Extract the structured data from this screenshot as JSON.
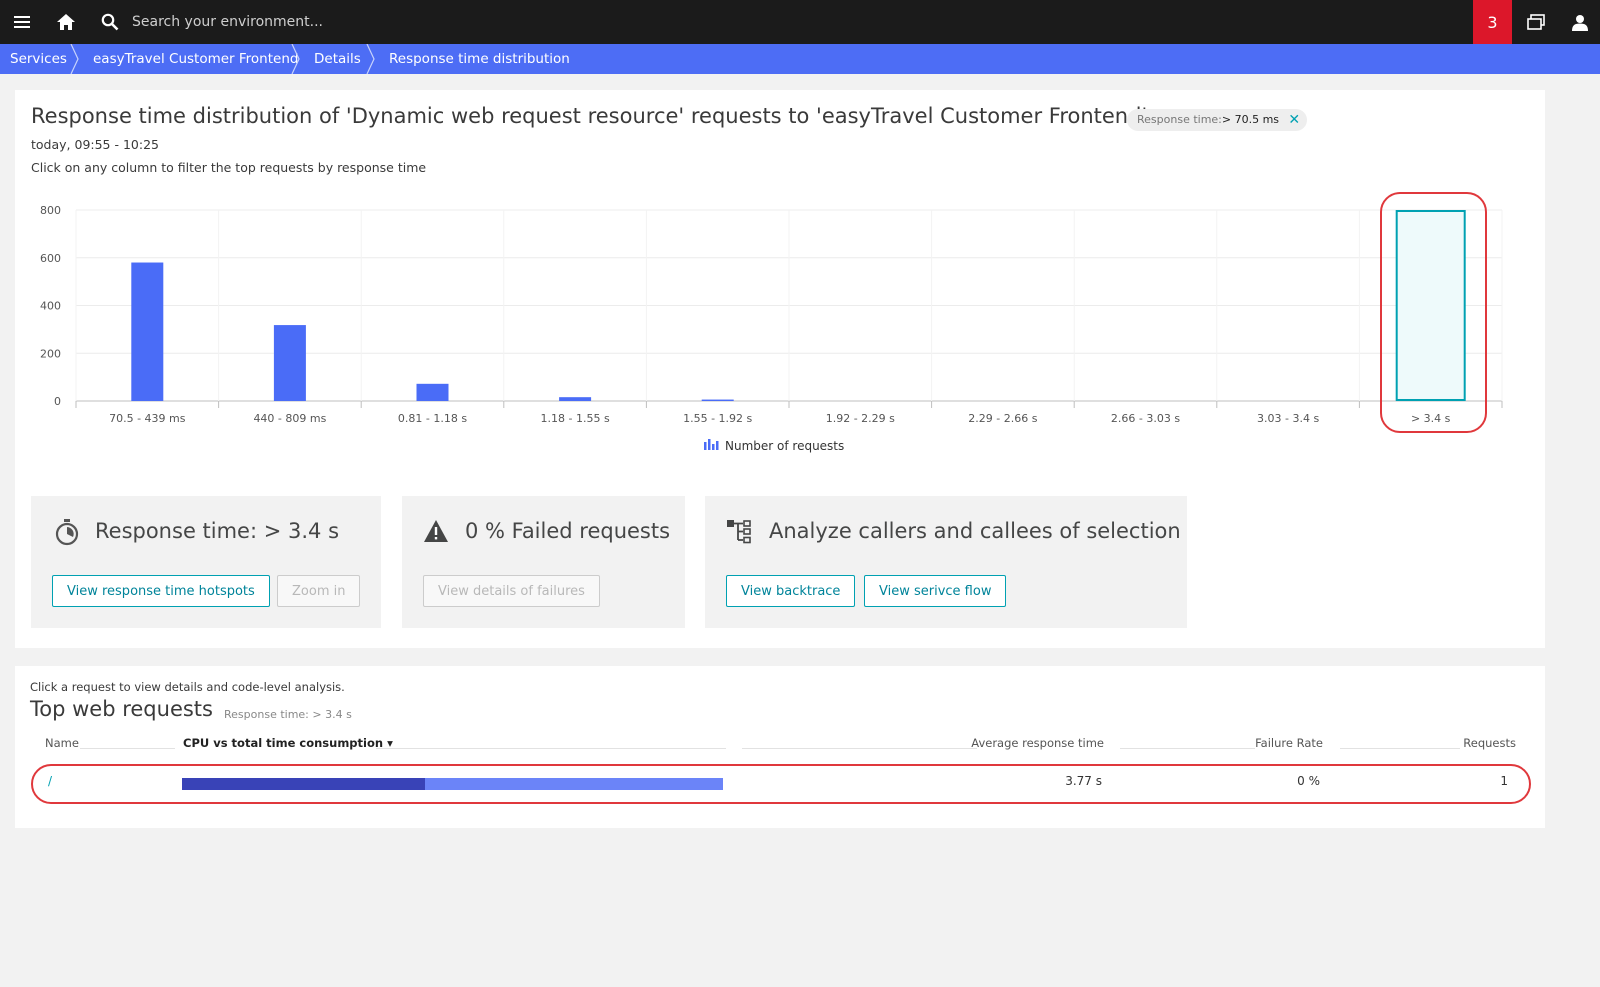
{
  "topbar": {
    "search_placeholder": "Search your environment...",
    "notification_count": "3"
  },
  "breadcrumb": [
    "Services",
    "easyTravel Customer Frontend",
    "Details",
    "Response time distribution"
  ],
  "header": {
    "title": "Response time distribution of 'Dynamic web request resource' requests to 'easyTravel Customer Frontend'",
    "filter_chip": {
      "label": "Response time:",
      "value": "> 70.5 ms"
    },
    "timeframe": "today, 09:55 - 10:25",
    "hint": "Click on any column to filter the top requests by response time"
  },
  "chart_data": {
    "type": "bar",
    "categories": [
      "70.5 - 439 ms",
      "440 - 809 ms",
      "0.81 - 1.18 s",
      "1.18 - 1.55 s",
      "1.55 - 1.92 s",
      "1.92 - 2.29 s",
      "2.29 - 2.66 s",
      "2.66 - 3.03 s",
      "3.03 - 3.4 s",
      "> 3.4 s"
    ],
    "series": [
      {
        "name": "Number of requests",
        "values": [
          580,
          318,
          72,
          16,
          6,
          0,
          0,
          0,
          0,
          1
        ]
      }
    ],
    "selected_category": "> 3.4 s",
    "ylim": [
      0,
      800
    ],
    "yticks": [
      "0",
      "200",
      "400",
      "600",
      "800"
    ],
    "grid": true,
    "legend": "bottom-center",
    "colors": {
      "bar": "#4a6cf7",
      "selected_fill": "#eefafb",
      "selected_border": "#00a1b2"
    }
  },
  "cards": {
    "response": {
      "title": "Response time: > 3.4 s",
      "button_primary": "View response time hotspots",
      "button_zoom": "Zoom in"
    },
    "failed": {
      "title": "0 % Failed requests",
      "button": "View details of failures"
    },
    "analyze": {
      "title": "Analyze callers and callees of selection",
      "button_backtrace": "View backtrace",
      "button_flow": "View serivce flow"
    }
  },
  "top_requests": {
    "hint": "Click a request to view details and code-level analysis.",
    "title": "Top web requests",
    "filter": "Response time: > 3.4 s",
    "columns": {
      "name": "Name",
      "consumption": "CPU vs total time consumption",
      "sort_icon": "▾",
      "avg": "Average response time",
      "failure": "Failure Rate",
      "requests": "Requests"
    },
    "rows": [
      {
        "name": "/",
        "cpu_share": 0.45,
        "avg": "3.77 s",
        "failure": "0 %",
        "requests": "1"
      }
    ]
  },
  "colors": {
    "accent": "#4d6df5",
    "teal": "#00a1b2",
    "alert": "#dc172a",
    "cpu_bar": "#3943b7",
    "total_bar": "#6b84f8",
    "highlight": "#e0383c"
  }
}
